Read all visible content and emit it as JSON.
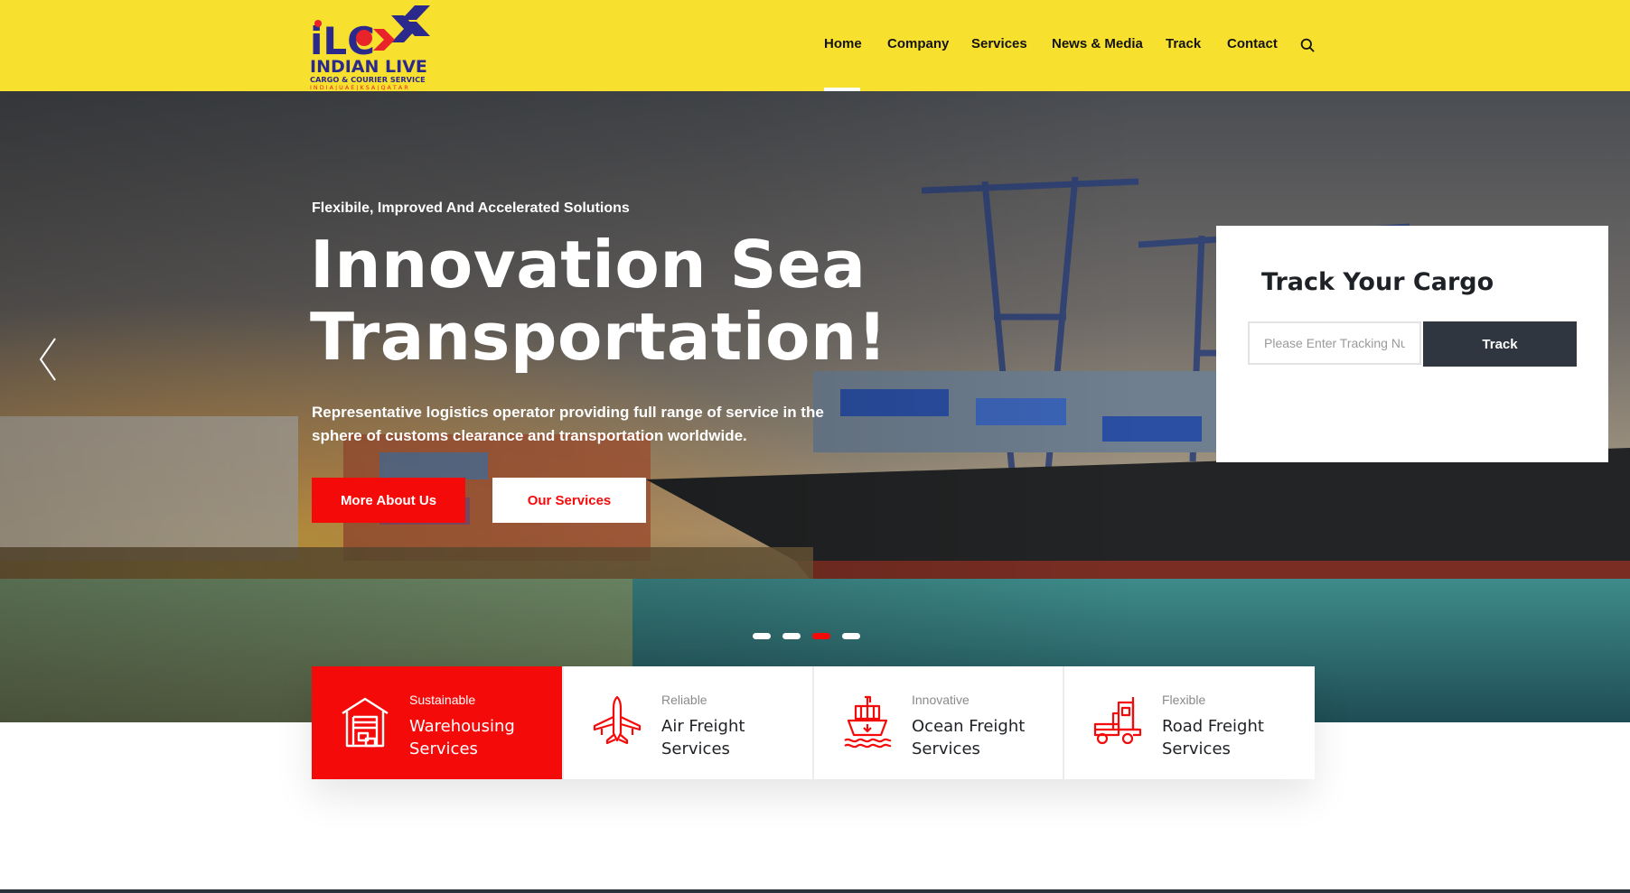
{
  "logo": {
    "mark_text": "iLC",
    "name": "INDIAN LIVE",
    "tagline": "CARGO & COURIER SERVICE",
    "regions": "I N D I A | U A E | K S A | Q A T A R",
    "colors": {
      "navy": "#2b2a8c",
      "red": "#e8232a",
      "gold": "#f1a81c"
    }
  },
  "nav": {
    "items": [
      {
        "label": "Home",
        "active": true
      },
      {
        "label": "Company",
        "active": false
      },
      {
        "label": "Services",
        "active": false
      },
      {
        "label": "News & Media",
        "active": false
      },
      {
        "label": "Track",
        "active": false
      },
      {
        "label": "Contact",
        "active": false
      }
    ],
    "search_icon": "search-icon"
  },
  "hero": {
    "eyebrow": "Flexibile, Improved And Accelerated Solutions",
    "headline_line1": "Innovation Sea",
    "headline_line2": "Transportation!",
    "description": "Representative logistics operator providing full range of service in the sphere of customs clearance and transportation worldwide.",
    "primary_button": "More About Us",
    "secondary_button": "Our Services",
    "prev_icon": "chevron-left-icon",
    "slide_count": 4,
    "active_slide": 3
  },
  "track": {
    "title": "Track Your Cargo",
    "input_placeholder": "Please Enter Tracking Number",
    "input_value": "",
    "button_label": "Track"
  },
  "services": [
    {
      "tag": "Sustainable",
      "name": "Warehousing Services",
      "icon": "warehouse-icon",
      "active": true
    },
    {
      "tag": "Reliable",
      "name": "Air Freight Services",
      "icon": "airplane-icon",
      "active": false
    },
    {
      "tag": "Innovative",
      "name": "Ocean Freight Services",
      "icon": "ship-icon",
      "active": false
    },
    {
      "tag": "Flexible",
      "name": "Road Freight Services",
      "icon": "truck-icon",
      "active": false
    }
  ],
  "colors": {
    "header_bg": "#f8e02f",
    "accent_red": "#f50a0a",
    "dark_button": "#2f3640"
  }
}
